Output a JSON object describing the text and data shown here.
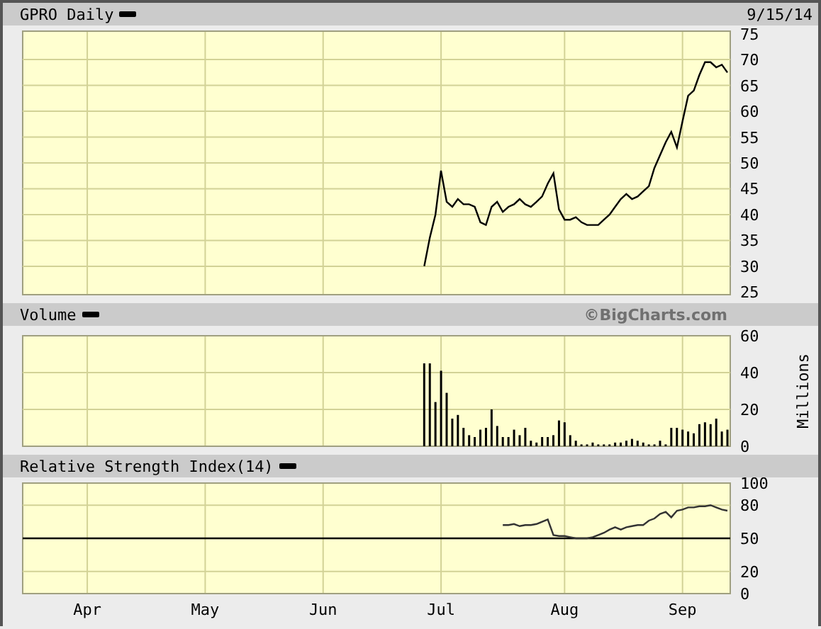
{
  "panels": [
    {
      "right_text": "9/15/14",
      "chart_data": {
        "type": "line",
        "title": "GPRO Daily",
        "grid": true,
        "ylim": [
          24.5,
          75.5
        ],
        "yticks": [
          25,
          30,
          35,
          40,
          45,
          50,
          55,
          60,
          65,
          70,
          75
        ],
        "categories": [
          null,
          null,
          null,
          null,
          null,
          null,
          null,
          null,
          null,
          null,
          null,
          null,
          null,
          null,
          null,
          null,
          null,
          null,
          null,
          null,
          null,
          null,
          null,
          null,
          null,
          null,
          null,
          null,
          null,
          null,
          null,
          null,
          null,
          null,
          null,
          null,
          null,
          null,
          null,
          null,
          null,
          null,
          null,
          null,
          null,
          null,
          null,
          null,
          null,
          null,
          null,
          null,
          null,
          null,
          null,
          null,
          null,
          null,
          null,
          null,
          null,
          null,
          null,
          null,
          null,
          null,
          null,
          null,
          null,
          null,
          null,
          null,
          null,
          null,
          null,
          null,
          null,
          null,
          null,
          null,
          null,
          null,
          null,
          null,
          null,
          null,
          null,
          null,
          null,
          null,
          null,
          null,
          null,
          null,
          null,
          null,
          null,
          null,
          null,
          null,
          null,
          null,
          null,
          null,
          null,
          null,
          null,
          null,
          null,
          null,
          null,
          null,
          null,
          null,
          null,
          null,
          null,
          null,
          null,
          null,
          null,
          null,
          null,
          null,
          null,
          null
        ],
        "series": [
          {
            "color": "#000000",
            "values": [
              null,
              null,
              null,
              null,
              null,
              null,
              null,
              null,
              null,
              null,
              null,
              null,
              null,
              null,
              null,
              null,
              null,
              null,
              null,
              null,
              null,
              null,
              null,
              null,
              null,
              null,
              null,
              null,
              null,
              null,
              null,
              null,
              null,
              null,
              null,
              null,
              null,
              null,
              null,
              null,
              null,
              null,
              null,
              null,
              null,
              null,
              null,
              null,
              null,
              null,
              null,
              null,
              null,
              null,
              null,
              null,
              null,
              null,
              null,
              null,
              null,
              null,
              null,
              null,
              null,
              null,
              null,
              null,
              null,
              null,
              null,
              30,
              35.5,
              40,
              48.5,
              42.5,
              41.5,
              43,
              42,
              42,
              41.5,
              38.5,
              38,
              41.5,
              42.5,
              40.5,
              41.5,
              42,
              43,
              42,
              41.5,
              42.5,
              43.5,
              46,
              48,
              41,
              39,
              39,
              39.5,
              38.5,
              38,
              38,
              38,
              39,
              40,
              41.5,
              43,
              44,
              43,
              43.5,
              44.5,
              45.5,
              49,
              51.5,
              54,
              56,
              53,
              58,
              63,
              64,
              67,
              69.5,
              69.5,
              68.5,
              69,
              67.5
            ]
          }
        ]
      }
    },
    {
      "right_text": "©BigCharts.com",
      "chart_data": {
        "type": "bar",
        "title": "Volume",
        "grid": true,
        "ylabel": "Millions",
        "ylim": [
          0,
          60
        ],
        "yticks": [
          0,
          20,
          40,
          60
        ],
        "categories": [
          null,
          null,
          null,
          null,
          null,
          null,
          null,
          null,
          null,
          null,
          null,
          null,
          null,
          null,
          null,
          null,
          null,
          null,
          null,
          null,
          null,
          null,
          null,
          null,
          null,
          null,
          null,
          null,
          null,
          null,
          null,
          null,
          null,
          null,
          null,
          null,
          null,
          null,
          null,
          null,
          null,
          null,
          null,
          null,
          null,
          null,
          null,
          null,
          null,
          null,
          null,
          null,
          null,
          null,
          null,
          null,
          null,
          null,
          null,
          null,
          null,
          null,
          null,
          null,
          null,
          null,
          null,
          null,
          null,
          null,
          null,
          null,
          null,
          null,
          null,
          null,
          null,
          null,
          null,
          null,
          null,
          null,
          null,
          null,
          null,
          null,
          null,
          null,
          null,
          null,
          null,
          null,
          null,
          null,
          null,
          null,
          null,
          null,
          null,
          null,
          null,
          null,
          null,
          null,
          null,
          null,
          null,
          null,
          null,
          null,
          null,
          null,
          null,
          null,
          null,
          null,
          null,
          null,
          null,
          null,
          null,
          null,
          null,
          null,
          null,
          null
        ],
        "series": [
          {
            "color": "#000000",
            "values": [
              null,
              null,
              null,
              null,
              null,
              null,
              null,
              null,
              null,
              null,
              null,
              null,
              null,
              null,
              null,
              null,
              null,
              null,
              null,
              null,
              null,
              null,
              null,
              null,
              null,
              null,
              null,
              null,
              null,
              null,
              null,
              null,
              null,
              null,
              null,
              null,
              null,
              null,
              null,
              null,
              null,
              null,
              null,
              null,
              null,
              null,
              null,
              null,
              null,
              null,
              null,
              null,
              null,
              null,
              null,
              null,
              null,
              null,
              null,
              null,
              null,
              null,
              null,
              null,
              null,
              null,
              null,
              null,
              null,
              null,
              null,
              45,
              45,
              24,
              41,
              29,
              15,
              17,
              10,
              6,
              5,
              9,
              10,
              20,
              11,
              5,
              5,
              9,
              6,
              10,
              3,
              2,
              5,
              5,
              6,
              14,
              13,
              6,
              3,
              1,
              1,
              2,
              1,
              1,
              1,
              2,
              2,
              3,
              4,
              3,
              2,
              1,
              1,
              3,
              1,
              10,
              10,
              9,
              8,
              7,
              12,
              13,
              12,
              15,
              8,
              9
            ]
          }
        ]
      }
    },
    {
      "chart_data": {
        "type": "line",
        "title": "Relative Strength Index(14)",
        "grid": true,
        "ylim": [
          0,
          100
        ],
        "yticks": [
          0,
          20,
          50,
          80,
          100
        ],
        "ref_lines": [
          {
            "axis": "y",
            "value": 50
          }
        ],
        "categories": [
          null,
          null,
          null,
          null,
          null,
          null,
          null,
          null,
          null,
          null,
          null,
          "Apr",
          null,
          null,
          null,
          null,
          null,
          null,
          null,
          null,
          null,
          null,
          null,
          null,
          null,
          null,
          null,
          null,
          null,
          null,
          null,
          null,
          "May",
          null,
          null,
          null,
          null,
          null,
          null,
          null,
          null,
          null,
          null,
          null,
          null,
          null,
          null,
          null,
          null,
          null,
          null,
          null,
          null,
          "Jun",
          null,
          null,
          null,
          null,
          null,
          null,
          null,
          null,
          null,
          null,
          null,
          null,
          null,
          null,
          null,
          null,
          null,
          null,
          null,
          null,
          "Jul",
          null,
          null,
          null,
          null,
          null,
          null,
          null,
          null,
          null,
          null,
          null,
          null,
          null,
          null,
          null,
          null,
          null,
          null,
          null,
          null,
          null,
          "Aug",
          null,
          null,
          null,
          null,
          null,
          null,
          null,
          null,
          null,
          null,
          null,
          null,
          null,
          null,
          null,
          null,
          null,
          null,
          null,
          null,
          "Sep",
          null,
          null,
          null,
          null,
          null,
          null,
          null,
          null
        ],
        "series": [
          {
            "color": "#333333",
            "values": [
              null,
              null,
              null,
              null,
              null,
              null,
              null,
              null,
              null,
              null,
              null,
              null,
              null,
              null,
              null,
              null,
              null,
              null,
              null,
              null,
              null,
              null,
              null,
              null,
              null,
              null,
              null,
              null,
              null,
              null,
              null,
              null,
              null,
              null,
              null,
              null,
              null,
              null,
              null,
              null,
              null,
              null,
              null,
              null,
              null,
              null,
              null,
              null,
              null,
              null,
              null,
              null,
              null,
              null,
              null,
              null,
              null,
              null,
              null,
              null,
              null,
              null,
              null,
              null,
              null,
              null,
              null,
              null,
              null,
              null,
              null,
              null,
              null,
              null,
              null,
              null,
              null,
              null,
              null,
              null,
              null,
              null,
              null,
              null,
              null,
              62,
              62,
              63,
              61,
              62,
              62,
              63,
              65,
              67,
              53,
              52,
              52,
              51,
              50,
              50,
              50,
              51,
              53,
              55,
              58,
              60,
              58,
              60,
              61,
              62,
              62,
              66,
              68,
              72,
              74,
              69,
              75,
              76,
              78,
              78,
              79,
              79,
              80,
              78,
              76,
              75
            ]
          }
        ]
      }
    }
  ]
}
